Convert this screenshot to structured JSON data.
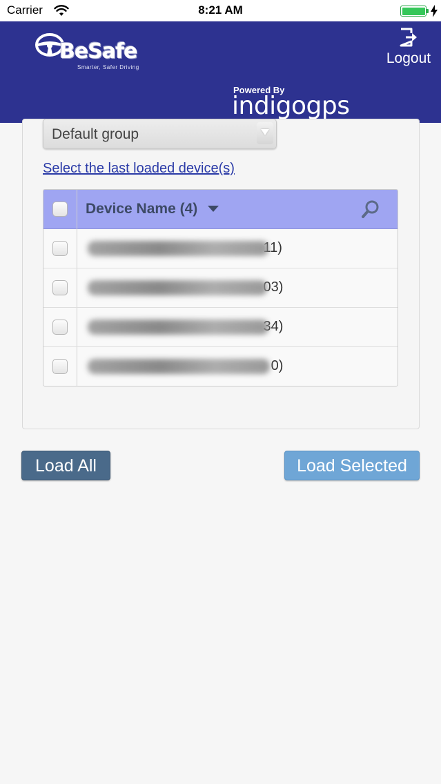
{
  "status_bar": {
    "carrier": "Carrier",
    "time": "8:21 AM",
    "battery_color": "#35c759"
  },
  "header": {
    "background": "#2d3290",
    "logo_name": "BeSafe",
    "logo_tagline": "Smarter, Safer Driving",
    "logout_label": "Logout",
    "logout_icon": "logout-icon",
    "powered_by": "Powered By",
    "powered_name": "indigogps"
  },
  "group_select": {
    "value": "Default group"
  },
  "select_last_link": "Select the last loaded device(s)",
  "device_table": {
    "header_title": "Device Name (4)",
    "header_color": "#9fa5f2",
    "rows": [
      {
        "visible_suffix": "11)"
      },
      {
        "visible_suffix": "03)"
      },
      {
        "visible_suffix": "34)"
      },
      {
        "visible_suffix": "0)"
      }
    ]
  },
  "buttons": {
    "load_all": "Load All",
    "load_selected": "Load Selected"
  }
}
